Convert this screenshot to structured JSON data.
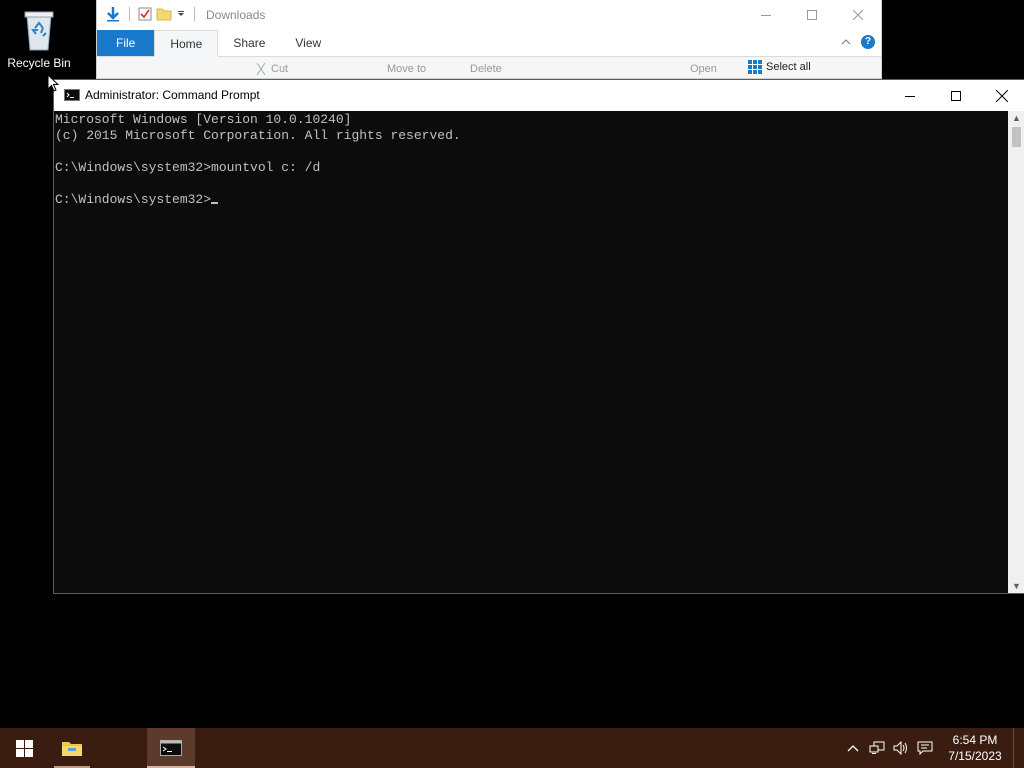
{
  "desktop": {
    "recycle_bin_label": "Recycle Bin"
  },
  "explorer": {
    "title": "Downloads",
    "tabs": [
      "File",
      "Home",
      "Share",
      "View"
    ],
    "ribbon": {
      "cut": "Cut",
      "move_to": "Move to",
      "delete": "Delete",
      "open": "Open",
      "select_all": "Select all"
    }
  },
  "cmd": {
    "title": "Administrator: Command Prompt",
    "lines": [
      "Microsoft Windows [Version 10.0.10240]",
      "(c) 2015 Microsoft Corporation. All rights reserved.",
      "",
      "C:\\Windows\\system32>mountvol c: /d",
      "",
      "C:\\Windows\\system32>"
    ]
  },
  "taskbar": {
    "time": "6:54 PM",
    "date": "7/15/2023"
  },
  "colors": {
    "taskbar_bg": "#3a1d10",
    "console_bg": "#0c0c0c",
    "console_fg": "#c0c0c0",
    "accent": "#1979ca"
  },
  "icons": [
    "recycle-bin-icon",
    "download-arrow-icon",
    "properties-check-icon",
    "new-folder-icon",
    "cmd-icon",
    "minimize-icon",
    "maximize-icon",
    "close-icon",
    "windows-logo-icon",
    "file-explorer-icon",
    "chevron-up-icon",
    "network-icon",
    "volume-icon",
    "action-center-icon",
    "help-icon",
    "mouse-pointer-icon"
  ]
}
